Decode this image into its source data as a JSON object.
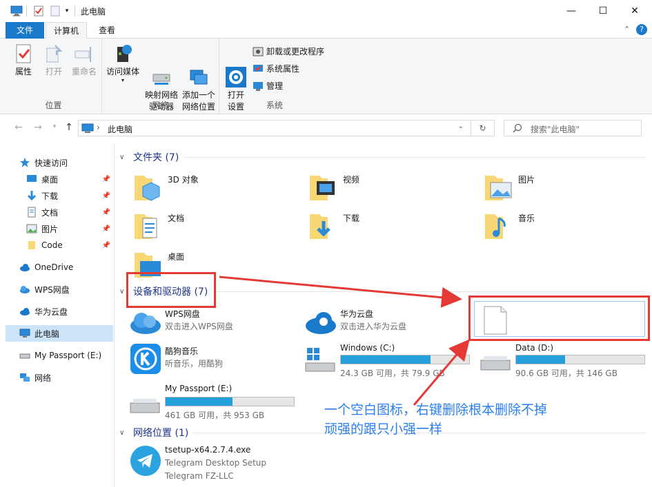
{
  "window": {
    "title": "此电脑",
    "minimize_glyph": "—",
    "maximize_glyph": "☐",
    "close_glyph": "✕"
  },
  "ribbon_tabs": [
    "文件",
    "计算机",
    "查看"
  ],
  "ribbon": {
    "groups": [
      {
        "label": "位置",
        "buttons": [
          "属性",
          "打开",
          "重命名"
        ]
      },
      {
        "label": "网络",
        "buttons": [
          "访问媒体",
          "映射网络\n驱动器",
          "添加一个\n网络位置"
        ]
      },
      {
        "label": "系统",
        "buttons": [
          "打开\n设置"
        ],
        "small": [
          "卸载或更改程序",
          "系统属性",
          "管理"
        ]
      }
    ]
  },
  "address": {
    "path": "此电脑",
    "separator": "›",
    "search_placeholder": "搜索\"此电脑\""
  },
  "nav": {
    "quick_access": "快速访问",
    "quick_items": [
      "桌面",
      "下载",
      "文档",
      "图片",
      "Code"
    ],
    "others": [
      "OneDrive",
      "WPS网盘",
      "华为云盘",
      "此电脑",
      "My Passport (E:)",
      "网络"
    ],
    "selected": "此电脑"
  },
  "sections": {
    "folders": "文件夹 (7)",
    "devices": "设备和驱动器 (7)",
    "network": "网络位置 (1)"
  },
  "folders": [
    "3D 对象",
    "视频",
    "图片",
    "文档",
    "下载",
    "音乐",
    "桌面"
  ],
  "devices": [
    {
      "name": "WPS网盘",
      "sub": "双击进入WPS网盘"
    },
    {
      "name": "华为云盘",
      "sub": "双击进入华为云盘"
    },
    {
      "name": "酷狗音乐",
      "sub": "听音乐，用酷狗"
    },
    {
      "name": "Windows (C:)",
      "sub": "24.3 GB 可用，共 79.9 GB",
      "used_fraction": 0.7
    },
    {
      "name": "Data (D:)",
      "sub": "90.6 GB 可用，共 146 GB",
      "used_fraction": 0.38
    },
    {
      "name": "My Passport (E:)",
      "sub": "461 GB 可用，共 953 GB",
      "used_fraction": 0.52
    }
  ],
  "network_items": [
    {
      "name": "tsetup-x64.2.7.4.exe",
      "line2": "Telegram Desktop Setup",
      "line3": "Telegram FZ-LLC"
    }
  ],
  "annotation": {
    "line1": "一个空白图标，右键删除根本删除不掉",
    "line2": "顽强的跟只小强一样",
    "color": "#e53935",
    "text_color": "#2b7ff0"
  },
  "colors": {
    "accent": "#1979ca",
    "bar_fill": "#26a0da",
    "section_text": "#1e3287",
    "selection": "#cce4f7"
  }
}
